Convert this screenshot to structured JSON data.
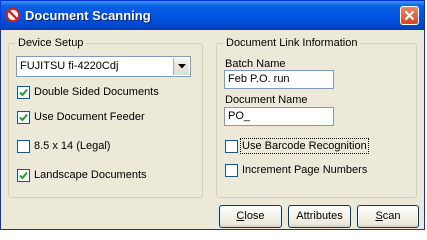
{
  "window": {
    "title": "Document Scanning",
    "icon": "no-sign-icon",
    "close_icon": "close-icon"
  },
  "device_setup": {
    "legend": "Device Setup",
    "scanner": {
      "selected": "FUJITSU fi-4220Cdj"
    },
    "options": [
      {
        "label": "Double Sided Documents",
        "checked": true
      },
      {
        "label": "Use Document Feeder",
        "checked": true
      },
      {
        "label": "8.5 x 14 (Legal)",
        "checked": false
      },
      {
        "label": "Landscape Documents",
        "checked": true
      }
    ]
  },
  "document_link": {
    "legend": "Document Link Information",
    "batch_name_label": "Batch Name",
    "batch_name_value": "Feb P.O. run",
    "document_name_label": "Document Name",
    "document_name_value": "PO_",
    "options": [
      {
        "label": "Use Barcode Recognition",
        "checked": false
      },
      {
        "label": "Increment Page Numbers",
        "checked": false
      }
    ]
  },
  "buttons": {
    "close": {
      "accel": "C",
      "rest": "lose"
    },
    "attributes": {
      "label": "Attributes"
    },
    "scan": {
      "accel": "S",
      "rest": "can"
    }
  },
  "colors": {
    "titlebar": "#0054e3",
    "dialog_bg": "#ece9d8",
    "check_mark": "#21a121",
    "close_button": "#d2481f"
  }
}
